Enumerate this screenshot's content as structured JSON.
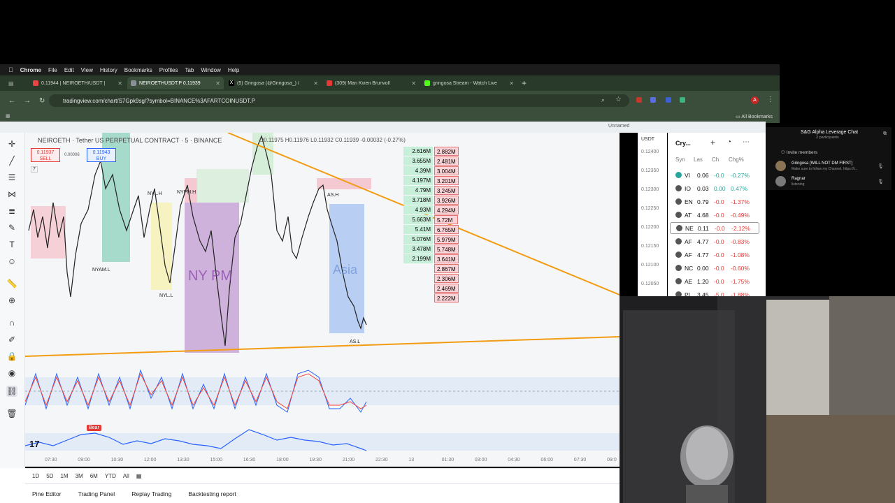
{
  "menubar": {
    "app": "Chrome",
    "items": [
      "File",
      "Edit",
      "View",
      "History",
      "Bookmarks",
      "Profiles",
      "Tab",
      "Window",
      "Help"
    ]
  },
  "tabs": [
    {
      "label": "0.11944 | NEIROETH/USDT |",
      "color": "#e84545"
    },
    {
      "label": "NEIROETHUSDT.P 0.11939",
      "color": "#8a8f98"
    },
    {
      "label": "(5) Gringosa (@Gringosa_) /",
      "color": "#000000"
    },
    {
      "label": "(309) Mari Kvien Brunvoll",
      "color": "#e53935"
    },
    {
      "label": "gringosa Stream - Watch Live",
      "color": "#53fc18"
    }
  ],
  "url": "tradingview.com/chart/S7Gpk9sg/?symbol=BINANCE%3AFARTCOINUSDT.P",
  "bookmarks_label": "All Bookmarks",
  "tv_top": {
    "unnamed": "Unnamed"
  },
  "chart": {
    "title": "NEIROETH · Tether US PERPETUAL CONTRACT · 5 · BINANCE",
    "ohlc": "O0.11975 H0.11976 L0.11932 C0.11939 -0.00032 (-0.27%)",
    "sell_price": "0.11937",
    "sell_label": "SELL",
    "spread": "0.00006",
    "buy_price": "0.11943",
    "buy_label": "BUY",
    "indicator_count": "7",
    "labels": {
      "nyl_h": "NYL.H",
      "nypm_h": "NYPM.H",
      "nyam_l": "NYAM.L",
      "nyl_l": "NYL.L",
      "as_h": "AS.H",
      "as_l": "AS.L",
      "nypm": "NY PM",
      "asia": "Asia",
      "bear": "Bear"
    },
    "volume_profile": [
      {
        "left": "2.616M",
        "right": "2.882M"
      },
      {
        "left": "3.655M",
        "right": "2.481M"
      },
      {
        "left": "4.39M",
        "right": "3.004M"
      },
      {
        "left": "4.197M",
        "right": "3.201M"
      },
      {
        "left": "4.79M",
        "right": "3.245M"
      },
      {
        "left": "3.718M",
        "right": "3.926M"
      },
      {
        "left": "4.93M",
        "right": "4.294M"
      },
      {
        "left": "5.663M",
        "right": "5.72M"
      },
      {
        "left": "5.41M",
        "right": "6.765M"
      },
      {
        "left": "5.076M",
        "right": "5.979M"
      },
      {
        "left": "3.478M",
        "right": "5.748M"
      },
      {
        "left": "2.199M",
        "right": "3.641M"
      },
      {
        "left": "",
        "right": "2.867M"
      },
      {
        "left": "",
        "right": "2.306M"
      },
      {
        "left": "",
        "right": "2.469M"
      },
      {
        "left": "",
        "right": "2.222M"
      }
    ],
    "price_axis_currency": "USDT",
    "price_ticks": [
      "0.12400",
      "0.12350",
      "0.12300",
      "0.12250",
      "0.12200",
      "0.12150",
      "0.12100",
      "0.12050"
    ],
    "time_ticks": [
      "07:30",
      "09:00",
      "10:30",
      "12:00",
      "13:30",
      "15:00",
      "16:30",
      "18:00",
      "19:30",
      "21:00",
      "22:30",
      "13",
      "01:30",
      "03:00",
      "04:30",
      "06:00",
      "07:30",
      "09:0"
    ]
  },
  "watchlist": {
    "title": "Cry...",
    "headers": [
      "Syn",
      "Las",
      "Ch",
      "Chg%"
    ],
    "rows": [
      {
        "sym": "VI",
        "last": "0.06",
        "ch": "-0.0",
        "chg": "-0.27%",
        "color": "#26a69a"
      },
      {
        "sym": "IO",
        "last": "0.03",
        "ch": "0.00",
        "chg": "0.47%",
        "color": "#26a69a"
      },
      {
        "sym": "EN",
        "last": "0.79",
        "ch": "-0.0",
        "chg": "-1.37%",
        "color": "#e53935"
      },
      {
        "sym": "AT",
        "last": "4.68",
        "ch": "-0.0",
        "chg": "-0.49%",
        "color": "#e53935"
      },
      {
        "sym": "NE",
        "last": "0.11",
        "ch": "-0.0",
        "chg": "-2.12%",
        "color": "#e53935"
      },
      {
        "sym": "AF",
        "last": "4.77",
        "ch": "-0.0",
        "chg": "-0.83%",
        "color": "#e53935"
      },
      {
        "sym": "AF",
        "last": "4.77",
        "ch": "-0.0",
        "chg": "-1.08%",
        "color": "#e53935"
      },
      {
        "sym": "NC",
        "last": "0.00",
        "ch": "-0.0",
        "chg": "-0.60%",
        "color": "#e53935"
      },
      {
        "sym": "AE",
        "last": "1.20",
        "ch": "-0.0",
        "chg": "-1.75%",
        "color": "#e53935"
      },
      {
        "sym": "PI",
        "last": "3.45",
        "ch": "-5.0",
        "chg": "-1.88%",
        "color": "#e53935"
      }
    ]
  },
  "timeframes": [
    "1D",
    "5D",
    "1M",
    "3M",
    "6M",
    "YTD",
    "All"
  ],
  "panels": [
    "Pine Editor",
    "Trading Panel",
    "Replay Trading",
    "Backtesting report"
  ],
  "discord": {
    "title": "S&G Alpha Leverage Chat",
    "subtitle": "2 participants",
    "invite": "Invite members",
    "users": [
      {
        "name": "Gringosa [WILL NOT DM FIRST]",
        "status": "Make sure to follow my Channel. https://t..."
      },
      {
        "name": "Ragnar",
        "status": "listening"
      }
    ]
  },
  "colors": {
    "accent_green": "#26a69a",
    "accent_red": "#e53935",
    "orange_line": "#f39c12",
    "tv_blue": "#2962ff"
  }
}
